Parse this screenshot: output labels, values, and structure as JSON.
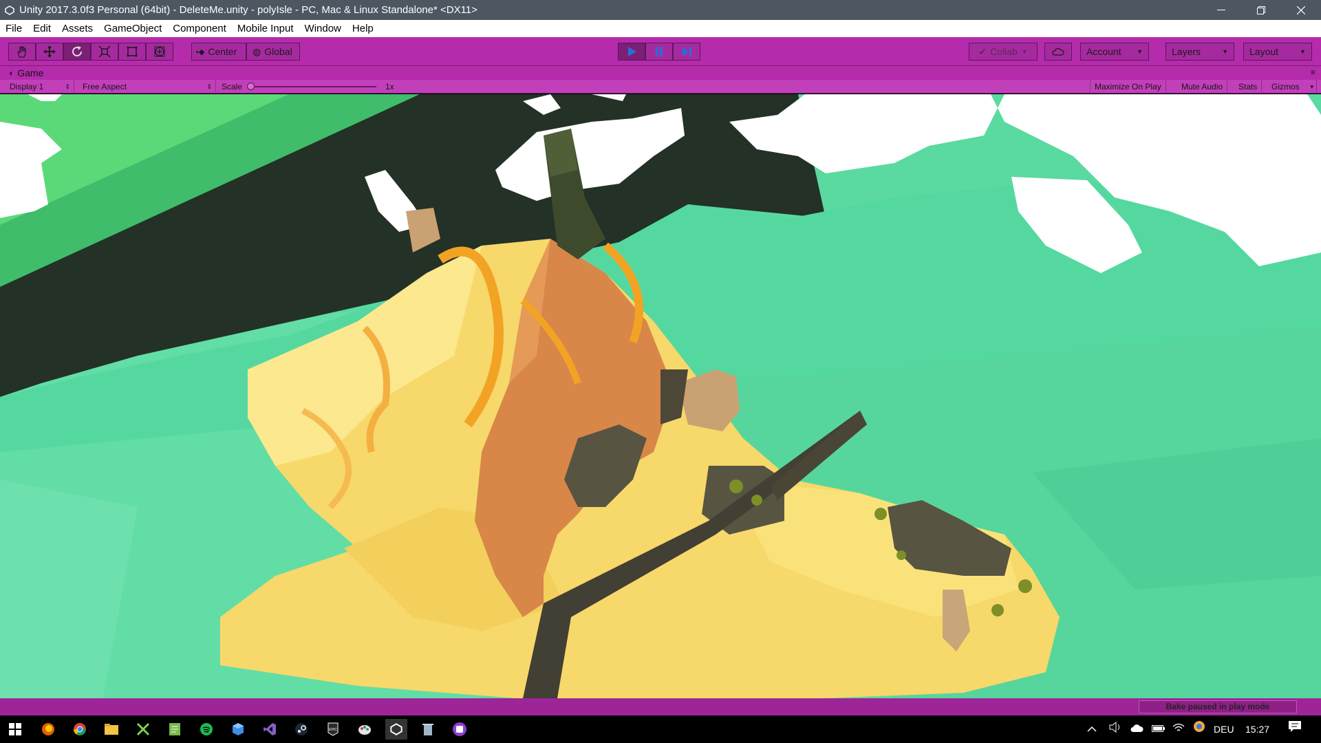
{
  "window": {
    "title": "Unity 2017.3.0f3 Personal (64bit) - DeleteMe.unity - polyIsle - PC, Mac & Linux Standalone* <DX11>"
  },
  "menu": [
    "File",
    "Edit",
    "Assets",
    "GameObject",
    "Component",
    "Mobile Input",
    "Window",
    "Help"
  ],
  "toolbar": {
    "pivot_label": "Center",
    "space_label": "Global",
    "collab_label": "Collab",
    "account_label": "Account",
    "layers_label": "Layers",
    "layout_label": "Layout"
  },
  "game": {
    "tab_label": "Game",
    "display_label": "Display 1",
    "aspect_label": "Free Aspect",
    "scale_label": "Scale",
    "scale_value": "1x",
    "maximize_label": "Maximize On Play",
    "mute_label": "Mute Audio",
    "stats_label": "Stats",
    "gizmos_label": "Gizmos"
  },
  "status": {
    "bake_message": "Bake paused in play mode"
  },
  "taskbar": {
    "language": "DEU",
    "time": "15:27"
  },
  "colors": {
    "editor_accent": "#b42bab",
    "play_active": "#2b6cd8",
    "ocean": "#5ad9a0",
    "sand": "#f5d56a"
  }
}
